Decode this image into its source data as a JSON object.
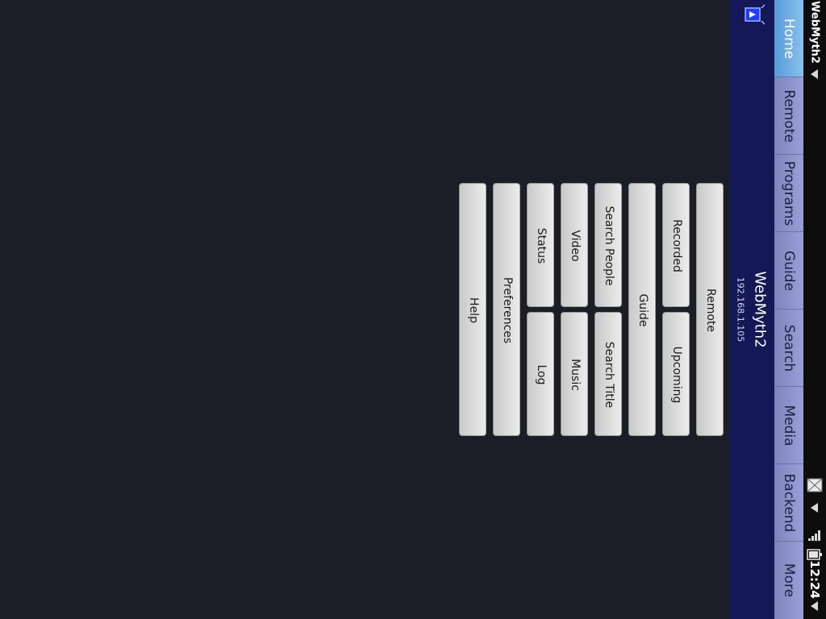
{
  "statusbar": {
    "app_title": "WebMyth2",
    "time": "12:24",
    "icons": [
      "dropdown-arrow-icon",
      "mail-icon",
      "signal-icon",
      "battery-icon"
    ]
  },
  "tabs": [
    {
      "label": "Home",
      "active": true
    },
    {
      "label": "Remote",
      "active": false
    },
    {
      "label": "Programs",
      "active": false
    },
    {
      "label": "Guide",
      "active": false
    },
    {
      "label": "Search",
      "active": false
    },
    {
      "label": "Media",
      "active": false
    },
    {
      "label": "Backend",
      "active": false
    },
    {
      "label": "More",
      "active": false
    }
  ],
  "header": {
    "title": "WebMyth2",
    "ip": "192.168.1.105",
    "icon": "mythtv-tv-icon"
  },
  "buttons": {
    "remote": "Remote",
    "recorded": "Recorded",
    "upcoming": "Upcoming",
    "guide": "Guide",
    "search_people": "Search People",
    "search_title": "Search Title",
    "video": "Video",
    "music": "Music",
    "status": "Status",
    "log": "Log",
    "preferences": "Preferences",
    "help": "Help"
  },
  "colors": {
    "background": "#1b1d27",
    "header": "#151857",
    "tabbar": "#8e94cd",
    "tab_active": "#6eaee6"
  }
}
